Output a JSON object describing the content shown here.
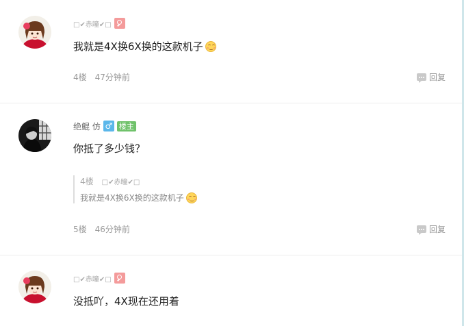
{
  "posts": [
    {
      "username": "□✔赤瞳✔□",
      "content": "我就是4X换6X换的这款机子",
      "floor": "4楼",
      "time": "47分钟前",
      "reply_label": "回复"
    },
    {
      "username": "绝鲲 仿",
      "op_badge": "楼主",
      "gender_symbol": "♂",
      "content": "你抵了多少钱？",
      "quote": {
        "floor": "4楼",
        "username": "□✔赤瞳✔□",
        "text": "我就是4X换6X换的这款机子"
      },
      "floor": "5楼",
      "time": "46分钟前",
      "reply_label": "回复"
    },
    {
      "username": "□✔赤瞳✔□",
      "content": "没抵吖，4X现在还用着"
    }
  ],
  "icons": {
    "search_badge": "search-badge-icon",
    "male": "male-icon",
    "smile": "smile-emoji-icon",
    "reply": "comment-bubble-icon"
  },
  "colors": {
    "op_badge": "#70c26b",
    "male_badge": "#5bb7ea",
    "search_badge": "#f49b9b"
  }
}
